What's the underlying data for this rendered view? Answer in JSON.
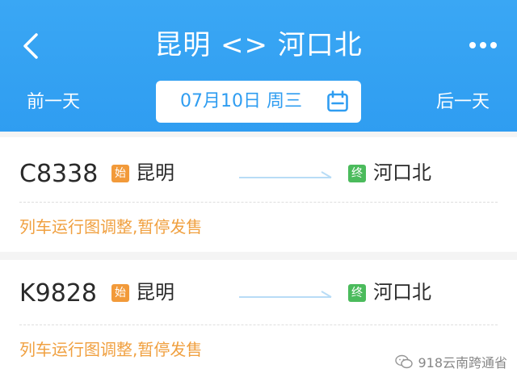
{
  "header": {
    "title": "昆明 <> 河口北",
    "prev_day": "前一天",
    "next_day": "后一天",
    "date": "07月10日 周三",
    "background": "#33a1f2"
  },
  "trains": [
    {
      "number": "C8338",
      "start_badge": "始",
      "from": "昆明",
      "end_badge": "终",
      "to": "河口北",
      "notice": "列车运行图调整,暂停发售"
    },
    {
      "number": "K9828",
      "start_badge": "始",
      "from": "昆明",
      "end_badge": "终",
      "to": "河口北",
      "notice": "列车运行图调整,暂停发售"
    }
  ],
  "watermark": {
    "text": "918云南跨通省"
  },
  "icons": {
    "back": "chevron-left-icon",
    "more": "more-dots-icon",
    "calendar": "calendar-icon"
  },
  "colors": {
    "accent": "#2f9df1",
    "notice": "#f0a040",
    "start_badge": "#f29a3a",
    "end_badge": "#4bbb5c"
  }
}
